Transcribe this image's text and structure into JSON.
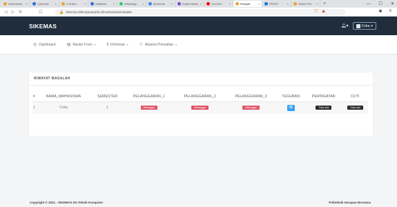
{
  "browser": {
    "tabs": [
      {
        "label": "Kebebasan",
        "color": "#e8a43c"
      },
      {
        "label": "Cyberlink",
        "color": "#2f6fd6"
      },
      {
        "label": "e-Kuliah",
        "color": "#e8a43c"
      },
      {
        "label": "Notifikasi",
        "color": "#2f6fd6"
      },
      {
        "label": "WhatsApp",
        "color": "#25d366"
      },
      {
        "label": "Bluetooth",
        "color": "#4285f4"
      },
      {
        "label": "Kotak Masuk",
        "color": "#7a4fd0"
      },
      {
        "label": "YouTube",
        "color": "#ff0000"
      },
      {
        "label": "Riwayat",
        "color": "#e8a43c"
      },
      {
        "label": "PEDRT",
        "color": "#1a73e8"
      },
      {
        "label": "Sistem Pre",
        "color": "#e8a43c"
      }
    ],
    "active_tab_index": 8,
    "url": "sikemas.d3komputerphb.id/mahasiswa/masalah"
  },
  "app": {
    "brand": "SIKEMAS",
    "user": "Coba",
    "menu": [
      {
        "label": "Dashboard",
        "icon": "dashboard-icon",
        "glyph": "◎"
      },
      {
        "label": "Master Form",
        "icon": "document-icon",
        "glyph": "▤",
        "dropdown": true
      },
      {
        "label": "Infromasi",
        "icon": "info-icon",
        "glyph": "ℹ",
        "dropdown": true
      },
      {
        "label": "Absensi Perwalian",
        "icon": "users-icon",
        "glyph": "⚇",
        "dropdown": true
      }
    ]
  },
  "card": {
    "title": "RIWAYAT MASALAH",
    "columns": [
      "#",
      "NAMA_MAHASISWA",
      "SEMESTER",
      "PELANGGARAN_1",
      "PELANGGARAN_2",
      "PELANGGARAN_3",
      "TEGURAN",
      "PERINGATAN",
      "CUTI"
    ],
    "rows": [
      {
        "no": "1",
        "nama": "Coba",
        "semester": "1",
        "p1": "Melanggar",
        "p2": "Melanggar",
        "p3": "Melanggar",
        "peringatan": "Tidak ada",
        "cuti": "Tidak ada"
      }
    ]
  },
  "footer": {
    "left": "Copyright © 2021 - SIKEMAS D3 Teknik Komputer",
    "right": "Politeknik Harapan Bersama"
  },
  "colors": {
    "header_bg": "#1f2d3d",
    "badge_red": "#e0566b",
    "badge_dark": "#2b2b2b",
    "eye_button": "#3aa0f5"
  }
}
